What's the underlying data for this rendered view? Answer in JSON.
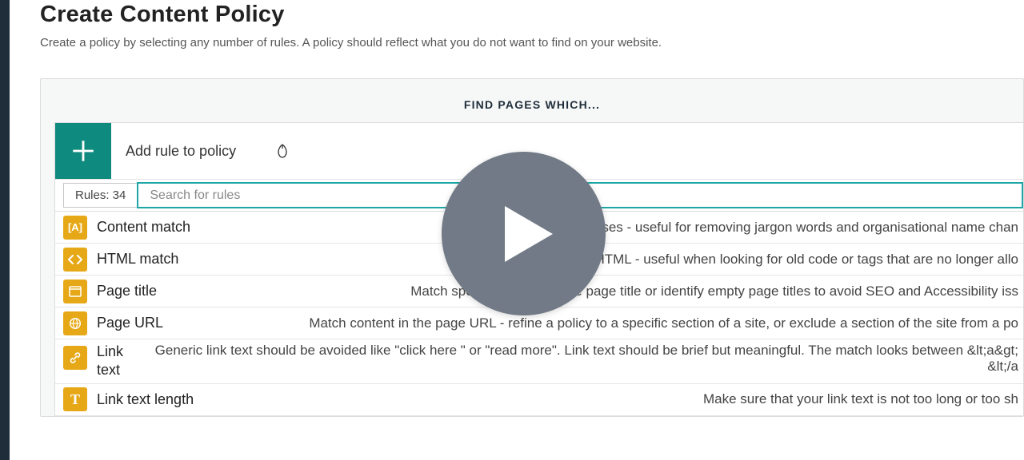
{
  "page": {
    "title": "Create Content Policy",
    "subtitle": "Create a policy by selecting any number of rules. A policy should reflect what you do not want to find on your website."
  },
  "panel": {
    "heading": "FIND PAGES WHICH...",
    "add_label": "Add rule to policy",
    "rules_count": "Rules: 34",
    "search_placeholder": "Search for rules"
  },
  "rules": [
    {
      "label": "Content match",
      "desc": "Mat                                                    phrases - useful for removing jargon words and organisational name chan"
    },
    {
      "label": "HTML match",
      "desc": "ontent in HTML - useful when looking for old code or tags that are no longer allo"
    },
    {
      "label": "Page title",
      "desc": "Match specific content in the page title or identify empty page titles to avoid SEO and Accessibility iss"
    },
    {
      "label": "Page URL",
      "desc": "Match content in the page URL - refine a policy to a specific section of a site, or exclude a section of the site from a po"
    },
    {
      "label": "Link text",
      "desc": "Generic link text should be avoided like \"click here \" or \"read more\". Link text should be brief but meaningful. The match looks between &lt;a&gt; &lt;/a"
    },
    {
      "label": "Link text length",
      "desc": "Make sure that your link text is not too long or too sh"
    }
  ]
}
